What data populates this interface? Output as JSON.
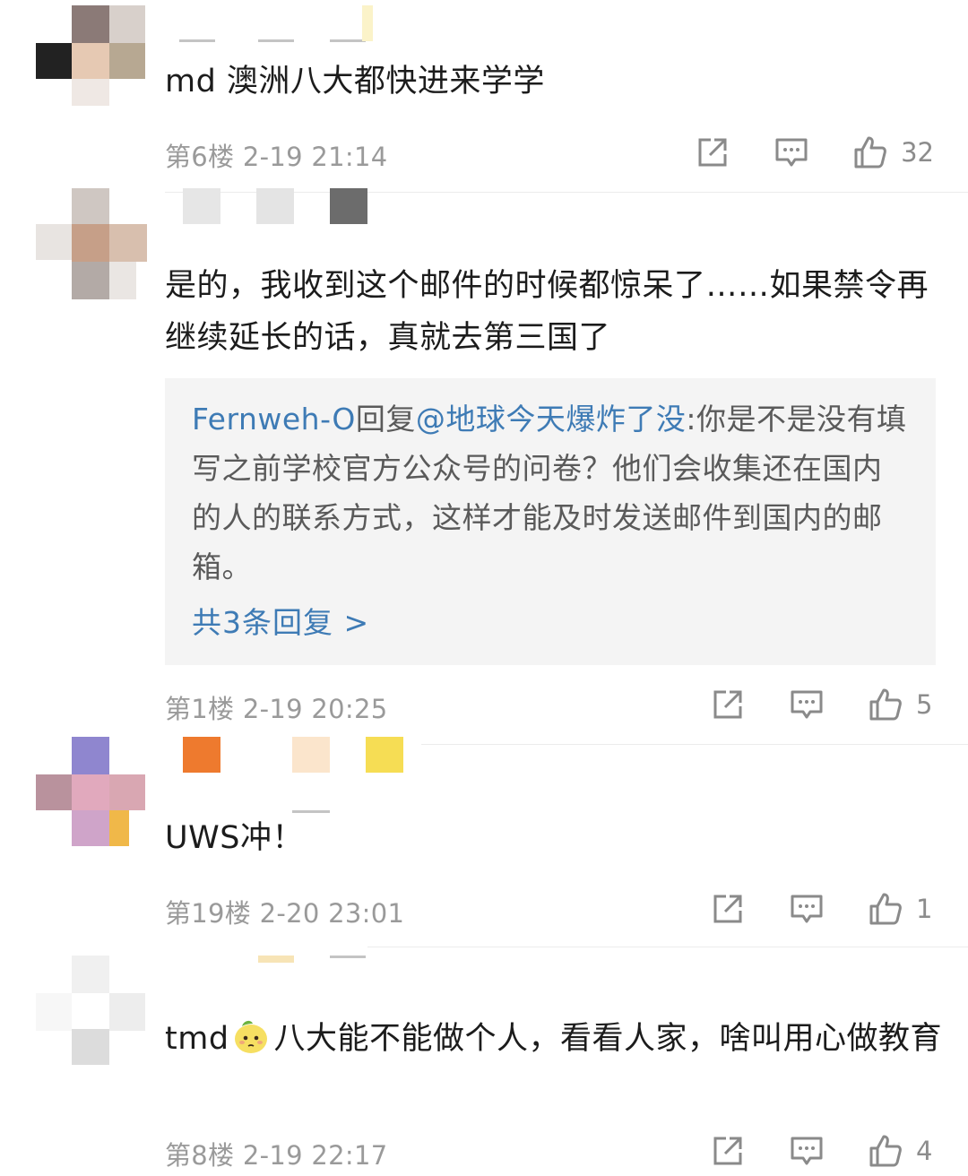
{
  "colors": {
    "link": "#3e7bb5",
    "meta": "#9a9a9a",
    "reply_bg": "#f4f4f4"
  },
  "comments": [
    {
      "text": "md 澳洲八大都快进来学学",
      "floor": "第6楼",
      "time": "2-19 21:14",
      "likes": "32",
      "icons": [
        "share-icon",
        "comment-icon",
        "thumbs-up-icon"
      ]
    },
    {
      "text": "是的，我收到这个邮件的时候都惊呆了……如果禁令再继续延长的话，真就去第三国了",
      "floor": "第1楼",
      "time": "2-19 20:25",
      "likes": "5",
      "reply": {
        "author": "Fernweh-O",
        "verb": "回复",
        "mention": "@地球今天爆炸了没",
        "text": ":你是不是没有填写之前学校官方公众号的问卷？他们会收集还在国内的人的联系方式，这样才能及时发送邮件到国内的邮箱。",
        "more": "共3条回复 >"
      }
    },
    {
      "text": "UWS冲！",
      "floor": "第19楼",
      "time": "2-20 23:01",
      "likes": "1"
    },
    {
      "text_before": "tmd",
      "emoji": "lemon-face-emoji",
      "text_after": "八大能不能做个人，看看人家，啥叫用心做教育",
      "floor": "第8楼",
      "time": "2-19 22:17",
      "likes": "4"
    }
  ]
}
